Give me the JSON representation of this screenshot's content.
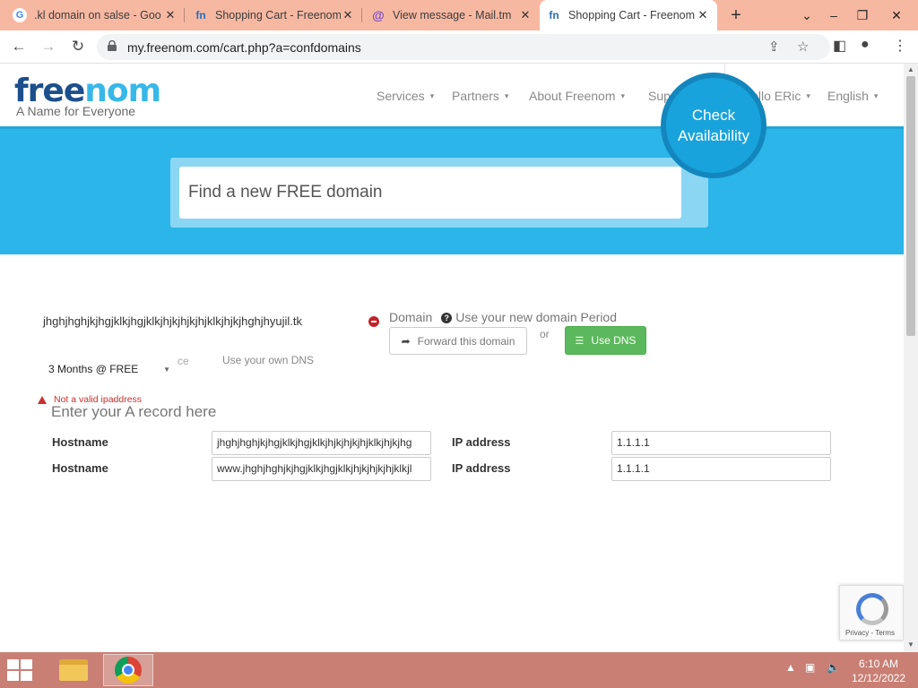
{
  "browser": {
    "tabs": [
      {
        "title": ".kl domain on salse - Goo",
        "icon": "google-icon"
      },
      {
        "title": "Shopping Cart - Freenom",
        "icon": "freenom-icon"
      },
      {
        "title": "View message - Mail.tm",
        "icon": "mailtm-icon"
      },
      {
        "title": "Shopping Cart - Freenom",
        "icon": "freenom-icon",
        "active": true
      }
    ],
    "url": "my.freenom.com/cart.php?a=confdomains"
  },
  "site": {
    "logo_free": "free",
    "logo_nom": "nom",
    "tagline": "A Name for Everyone",
    "nav": [
      "Services",
      "Partners",
      "About Freenom",
      "Support"
    ],
    "user": "Hello ERic",
    "language": "English"
  },
  "hero": {
    "search_placeholder": "Find a new FREE domain",
    "check_label_line1": "Check",
    "check_label_line2": "Availability"
  },
  "domain": {
    "name": "jhghjhghjkjhgjklkjhgjklkjhjkjhjkjhjklkjhjkjhghjhyujil.tk",
    "label": "Domain",
    "period_hint": "Use your new domain Period",
    "forward_label": "Forward this domain",
    "or_label": "or",
    "use_dns_label": "Use DNS",
    "period_value": "3 Months @ FREE",
    "ghost_text": "ce",
    "own_dns_label": "Use your own DNS",
    "error": "Not a valid ipaddress",
    "records_title": "Enter your A record here",
    "records": [
      {
        "host_label": "Hostname",
        "host_value": "jhghjhghjkjhgjklkjhgjklkjhjkjhjkjhjklkjhjkjhg",
        "ip_label": "IP address",
        "ip_value": "1.1.1.1"
      },
      {
        "host_label": "Hostname",
        "host_value": "www.jhghjhghjkjhgjklkjhgjklkjhjkjhjkjhjklkjl",
        "ip_label": "IP address",
        "ip_value": "1.1.1.1"
      }
    ]
  },
  "recaptcha": {
    "text": "Privacy - Terms"
  },
  "taskbar": {
    "time": "6:10 AM",
    "date": "12/12/2022"
  },
  "colors": {
    "hero": "#2bb5e8",
    "green": "#5cb85c",
    "freenom_blue": "#1c4f8c",
    "taskbar": "#c97f74",
    "tabstrip": "#f7b8a2"
  }
}
